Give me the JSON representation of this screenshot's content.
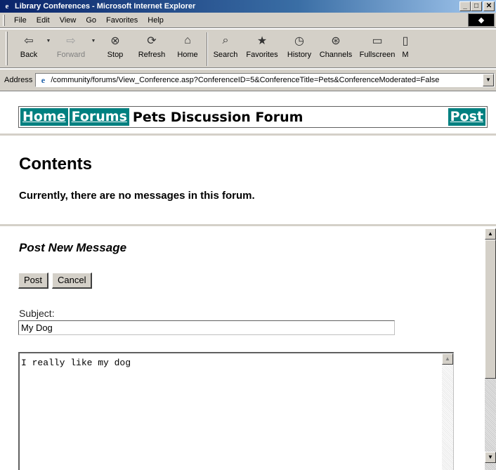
{
  "window": {
    "title": "Library Conferences - Microsoft Internet Explorer",
    "app_icon": "e",
    "minimize": "_",
    "maximize": "□",
    "close": "✕"
  },
  "menu": [
    "File",
    "Edit",
    "View",
    "Go",
    "Favorites",
    "Help"
  ],
  "toolbar": {
    "buttons": [
      {
        "label": "Back",
        "icon": "back-arrow-icon",
        "glyph": "⇦",
        "enabled": true
      },
      {
        "label": "Forward",
        "icon": "forward-arrow-icon",
        "glyph": "⇨",
        "enabled": false
      },
      {
        "label": "Stop",
        "icon": "stop-icon",
        "glyph": "⊗",
        "enabled": true
      },
      {
        "label": "Refresh",
        "icon": "refresh-icon",
        "glyph": "⟳",
        "enabled": true
      },
      {
        "label": "Home",
        "icon": "home-icon",
        "glyph": "⌂",
        "enabled": true
      },
      {
        "label": "Search",
        "icon": "search-icon",
        "glyph": "⌕",
        "enabled": true
      },
      {
        "label": "Favorites",
        "icon": "favorites-icon",
        "glyph": "★",
        "enabled": true
      },
      {
        "label": "History",
        "icon": "history-icon",
        "glyph": "◷",
        "enabled": true
      },
      {
        "label": "Channels",
        "icon": "channels-icon",
        "glyph": "⊛",
        "enabled": true
      },
      {
        "label": "Fullscreen",
        "icon": "fullscreen-icon",
        "glyph": "▭",
        "enabled": true
      },
      {
        "label": "M",
        "icon": "mail-icon",
        "glyph": "▯",
        "enabled": true
      }
    ]
  },
  "address": {
    "label": "Address",
    "url": "/community/forums/View_Conference.asp?ConferenceID=5&ConferenceTitle=Pets&ConferenceModerated=False"
  },
  "nav": {
    "home": "Home",
    "forums": "Forums",
    "title": "Pets Discussion Forum",
    "post": "Post",
    "link_bg": "#008080"
  },
  "contents": {
    "heading": "Contents",
    "message": "Currently, there are no messages in this forum."
  },
  "post_form": {
    "heading": "Post New Message",
    "post_button": "Post",
    "cancel_button": "Cancel",
    "subject_label": "Subject:",
    "subject_value": "My Dog",
    "body_value": "I really like my dog"
  }
}
